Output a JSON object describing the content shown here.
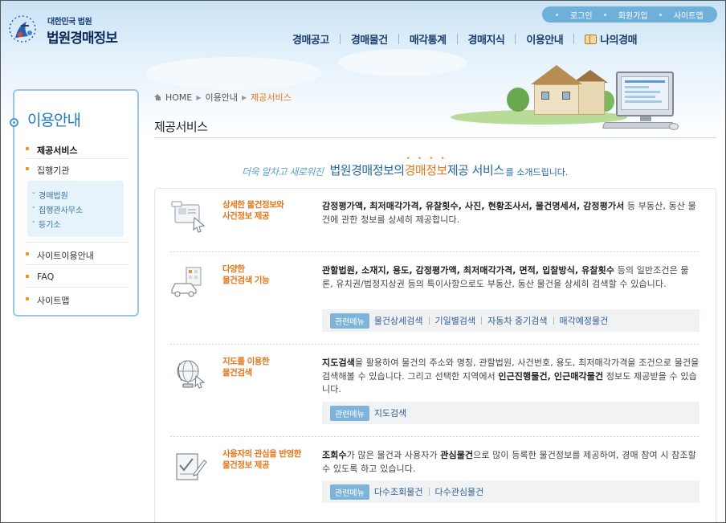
{
  "logo": {
    "line1": "대한민국 법원",
    "line2": "법원경매정보"
  },
  "util_nav": [
    "로그인",
    "회원가입",
    "사이트맵"
  ],
  "gnb": [
    "경매공고",
    "경매물건",
    "매각통계",
    "경매지식",
    "이용안내",
    "나의경매"
  ],
  "sidebar": {
    "title": "이용안내",
    "items": [
      "제공서비스",
      "집행기관",
      "사이트이용안내",
      "FAQ",
      "사이트맵"
    ],
    "subitems": [
      "경매법원",
      "집행관사무소",
      "등기소"
    ]
  },
  "breadcrumb": {
    "home": "HOME",
    "level1": "이용안내",
    "current": "제공서비스"
  },
  "page_title": "제공서비스",
  "intro": {
    "hand": "더욱 알차고 새로워진",
    "part1": "법원경매정보의",
    "part2": "경매정보",
    "part3": "제공 서비스",
    "part4": "를 소개드립니다."
  },
  "related_label": "관련메뉴",
  "sections": [
    {
      "title_line1": "상세한 물건정보와",
      "title_line2": "사건정보 제공",
      "desc_bold": "감정평가액, 최저매각가격, 유찰횟수, 사진, 현황조사서, 물건명세서, 감정평가서",
      "desc_rest": " 등 부동산, 동산 물건에 관한 정보를 상세히 제공합니다.",
      "links": []
    },
    {
      "title_line1": "다양한",
      "title_line2": "물건검색 기능",
      "desc_bold": "관할법원, 소재지, 용도, 감정평가액, 최저매각가격, 면적, 입찰방식, 유찰횟수",
      "desc_rest": " 등의 일반조건은 물론, 유치권/법정지상권 등의 특이사항으로도 부동산, 동산 물건을 상세히 검색할 수 있습니다.",
      "links": [
        "물건상세검색",
        "기일별검색",
        "자동차 중기검색",
        "매각예정물건"
      ]
    },
    {
      "title_line1": "지도를 이용한",
      "title_line2": "물건검색",
      "desc_bold": "지도검색",
      "desc_rest": "을 활용하여 물건의 주소와 명칭, 관할법원, 사건번호, 용도, 최저매각가격을 조건으로 물건을 검색해볼 수 있습니다. 그리고 선택한 지역에서 ",
      "desc_bold2": "인근진행물건, 인근매각물건",
      "desc_rest2": " 정보도 제공받을 수 있습니다.",
      "links": [
        "지도검색"
      ]
    },
    {
      "title_line1": "사용자의 관심을 반영한",
      "title_line2": "물건정보 제공",
      "desc_bold": "조회수",
      "desc_rest": "가 많은 물건과 사용자가 ",
      "desc_bold2": "관심물건",
      "desc_rest2": "으로 많이 등록한 물건정보를 제공하여, 경매 참여 시 참조할 수 있도록 하고 있습니다.",
      "links": [
        "다수조회물건",
        "다수관심물건"
      ]
    }
  ]
}
